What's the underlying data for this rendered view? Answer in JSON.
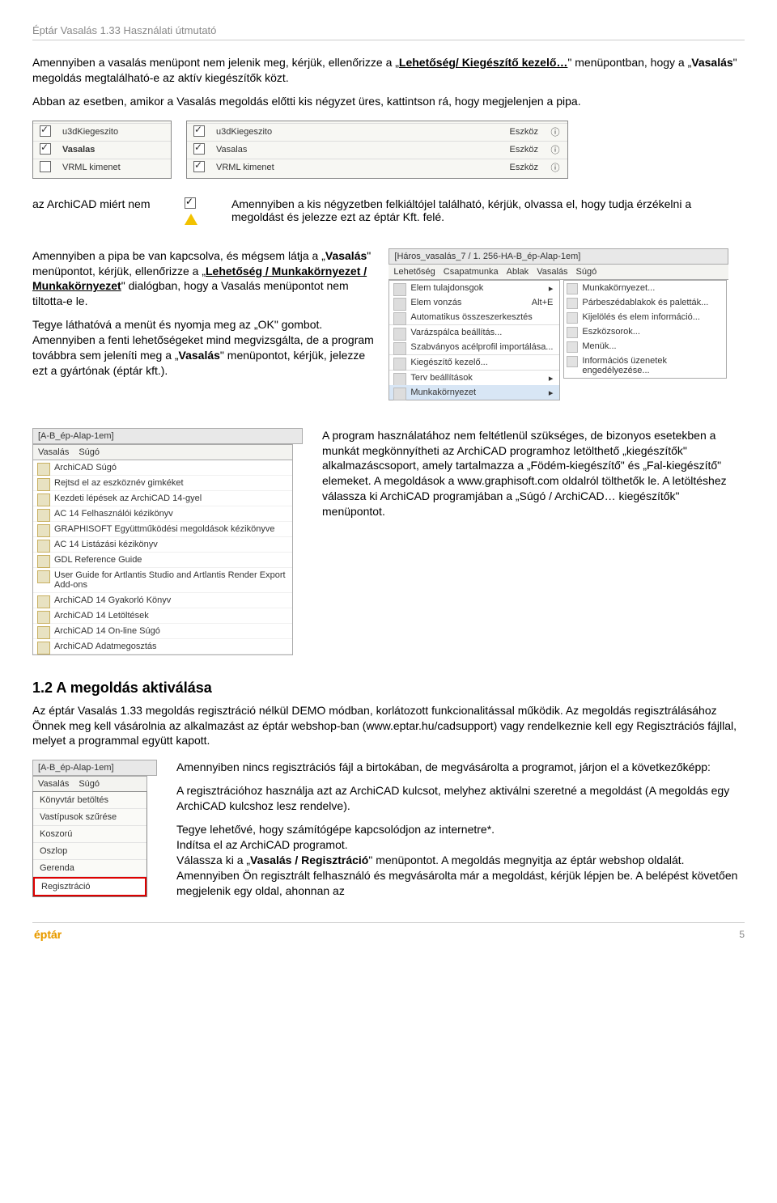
{
  "header": {
    "title": "Éptár Vasalás 1.33 Használati útmutató"
  },
  "intro": {
    "p1a": "Amennyiben a vasalás menüpont nem jelenik meg, kérjük, ellenőrizze a „",
    "p1b": "Lehetőség/ Kiegészítő kezelő…",
    "p1c": "\" menüpontban, hogy a „",
    "p1d": "Vasalás",
    "p1e": "\" megoldás megtalálható-e az aktív kiegészítők közt.",
    "p2": "Abban az esetben, amikor a Vasalás megoldás előtti kis négyzet üres, kattintson rá, hogy megjelenjen a pipa."
  },
  "addon_table_small": {
    "rows": [
      {
        "chk": true,
        "name": "u3dKiegeszito"
      },
      {
        "chk": true,
        "name": "Vasalas"
      },
      {
        "chk": false,
        "name": "VRML kimenet"
      }
    ]
  },
  "addon_table_wide": {
    "rows": [
      {
        "chk": true,
        "name": "u3dKiegeszito",
        "type": "Eszköz"
      },
      {
        "chk": true,
        "name": "Vasalas",
        "type": "Eszköz"
      },
      {
        "chk": true,
        "name": "VRML kimenet",
        "type": "Eszköz"
      }
    ]
  },
  "warn_row": {
    "left": "az ArchiCAD miért nem",
    "right": "Amennyiben a kis négyzetben felkiáltójel található, kérjük, olvassa el, hogy tudja érzékelni a megoldást és jelezze ezt az éptár Kft. felé."
  },
  "window_title": "[Háros_vasalás_7 / 1. 256-HA-B_ép-Alap-1em]",
  "tabs": [
    "Lehetőség",
    "Csapatmunka",
    "Ablak",
    "Vasalás",
    "Súgó"
  ],
  "options_menu": {
    "items": [
      {
        "label": "Elem tulajdonsgok",
        "arrow": true
      },
      {
        "label": "Elem vonzás",
        "extra": "Alt+E"
      },
      {
        "label": "Automatikus összeszerkesztés"
      },
      {
        "label": "Varázspálca beállítás..."
      },
      {
        "label": "Szabványos acélprofil importálása..."
      },
      {
        "label": "Kiegészítő kezelő..."
      },
      {
        "label": "Terv beállítások",
        "arrow": true
      },
      {
        "label": "Munkakörnyezet",
        "arrow": true
      }
    ]
  },
  "workspace_submenu": {
    "items": [
      "Munkakörnyezet...",
      "Párbeszédablakok és paletták...",
      "Kijelölés és elem információ...",
      "Eszközsorok...",
      "Menük...",
      "Információs üzenetek engedélyezése..."
    ]
  },
  "pipa_para": {
    "p1a": "Amennyiben a pipa be van kapcsolva, és mégsem látja a „",
    "p1b": "Vasalás",
    "p1c": "\" menüpontot, kérjük, ellenőrizze a „",
    "p1d": "Lehetőség / Munkakörnyezet / Munkakörnyezet",
    "p1e": "\" dialógban, hogy a Vasalás menüpontot nem tiltotta-e le.",
    "p2": "Tegye láthatóvá a menüt és nyomja meg az „OK\" gombot. Amennyiben a fenti lehetőségeket mind megvizsgálta, de a program továbbra sem jeleníti meg a „",
    "p2b": "Vasalás",
    "p2c": "\" menüpontot, kérjük, jelezze ezt a gyártónak (éptár kft.)."
  },
  "help_title": "[A-B_ép-Alap-1em]",
  "help_tabs": [
    "Vasalás",
    "Súgó"
  ],
  "help_items": [
    "ArchiCAD Súgó",
    "Rejtsd el az eszköznév gimkéket",
    "Kezdeti lépések az ArchiCAD 14-gyel",
    "AC 14 Felhasználói kézikönyv",
    "GRAPHISOFT Együttműködési megoldások kézikönyve",
    "AC 14 Listázási kézikönyv",
    "GDL Reference Guide",
    "User Guide for Artlantis Studio and Artlantis Render Export Add-ons",
    "ArchiCAD 14 Gyakorló Könyv",
    "ArchiCAD 14 Letöltések",
    "ArchiCAD 14 On-line Súgó",
    "ArchiCAD Adatmegosztás"
  ],
  "help_para": "A program használatához nem feltétlenül szükséges, de bizonyos esetekben a munkát megkönnyítheti az ArchiCAD programhoz letölthető „kiegészítők\" alkalmazáscsoport, amely tartalmazza a „Födém-kiegészítő\" és „Fal-kiegészítő\" elemeket. A megoldások a www.graphisoft.com oldalról tölthetők le. A letöltéshez válassza ki ArchiCAD programjában a „Súgó / ArchiCAD… kiegészítők\" menüpontot.",
  "section2": {
    "title": "1.2 A megoldás aktiválása",
    "p1": "Az éptár Vasalás 1.33 megoldás regisztráció nélkül DEMO módban, korlátozott funkcionalitással működik. Az megoldás regisztrálásához Önnek meg kell vásárolnia az alkalmazást az éptár webshop-ban (www.eptar.hu/cadsupport) vagy rendelkeznie kell egy Regisztrációs fájllal, melyet a programmal együtt kapott."
  },
  "reg_title": "[A-B_ép-Alap-1em]",
  "reg_tabs": [
    "Vasalás",
    "Súgó"
  ],
  "reg_menu": [
    "Könyvtár betöltés",
    "Vastípusok szűrése",
    "Koszorú",
    "Oszlop",
    "Gerenda",
    "Regisztráció"
  ],
  "reg_para": {
    "p1": "Amennyiben nincs regisztrációs fájl a birtokában, de megvásárolta a programot, járjon el a következőképp:",
    "p2": "A regisztrációhoz használja azt az ArchiCAD kulcsot, melyhez aktiválni szeretné a megoldást (A megoldás egy ArchiCAD kulcshoz lesz rendelve).",
    "p3": "Tegye lehetővé, hogy számítógépe kapcsolódjon az internetre*.",
    "p4": "Indítsa el az ArchiCAD programot.",
    "p5a": "Válassza ki a „",
    "p5b": "Vasalás / Regisztráció",
    "p5c": "\" menüpontot. A megoldás megnyitja az éptár webshop oldalát. Amennyiben Ön regisztrált felhasználó és megvásárolta már a megoldást, kérjük lépjen be. A belépést követően megjelenik egy oldal, ahonnan az"
  },
  "footer": {
    "logo": "éptár",
    "page": "5"
  }
}
